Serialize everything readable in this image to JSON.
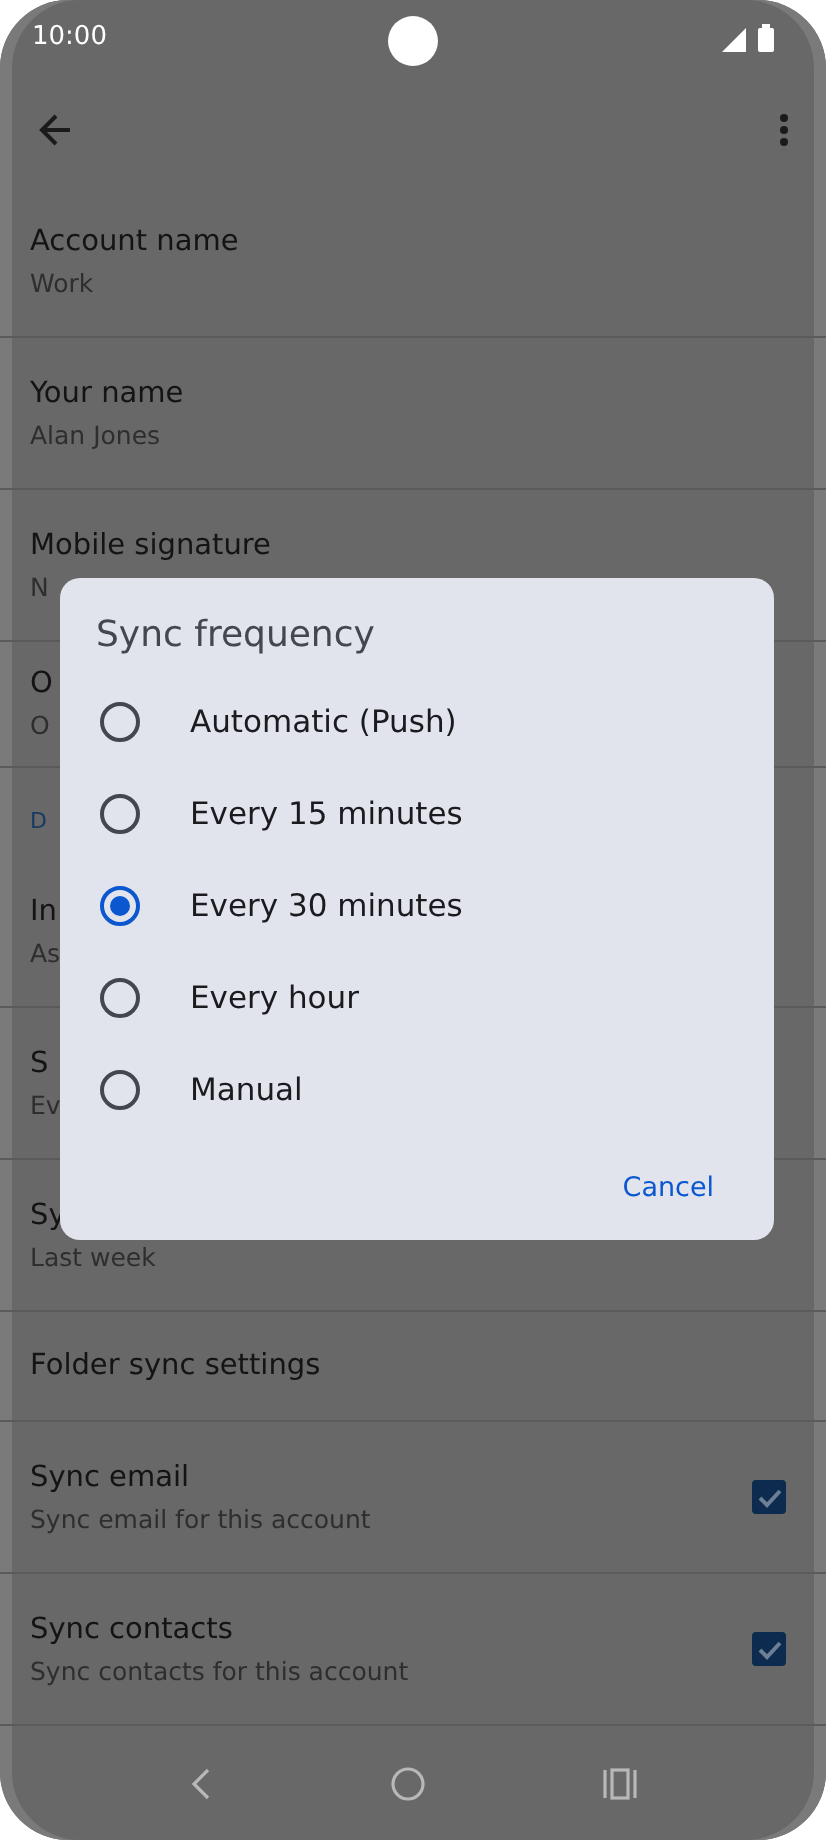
{
  "status_bar": {
    "time": "10:00"
  },
  "settings": [
    {
      "kind": "item",
      "title": "Account name",
      "subtitle": "Work"
    },
    {
      "kind": "item",
      "title": "Your name",
      "subtitle": "Alan Jones"
    },
    {
      "kind": "item",
      "title": "Mobile signature",
      "subtitle": "N"
    },
    {
      "kind": "item",
      "title": "O",
      "subtitle": "O"
    },
    {
      "kind": "header",
      "title": "D"
    },
    {
      "kind": "item",
      "title": "In",
      "subtitle": "As"
    },
    {
      "kind": "item",
      "title": "S",
      "subtitle": "Ev"
    },
    {
      "kind": "item",
      "title": "Sy",
      "subtitle": "Last week"
    },
    {
      "kind": "item",
      "title": "Folder sync settings"
    },
    {
      "kind": "check",
      "title": "Sync email",
      "subtitle": "Sync email for this account",
      "checked": true
    },
    {
      "kind": "check",
      "title": "Sync contacts",
      "subtitle": "Sync contacts for this account",
      "checked": true
    }
  ],
  "dialog": {
    "title": "Sync frequency",
    "options": [
      {
        "label": "Automatic (Push)",
        "selected": false
      },
      {
        "label": "Every 15 minutes",
        "selected": false
      },
      {
        "label": "Every 30 minutes",
        "selected": true
      },
      {
        "label": "Every hour",
        "selected": false
      },
      {
        "label": "Manual",
        "selected": false
      }
    ],
    "button": "Cancel"
  }
}
